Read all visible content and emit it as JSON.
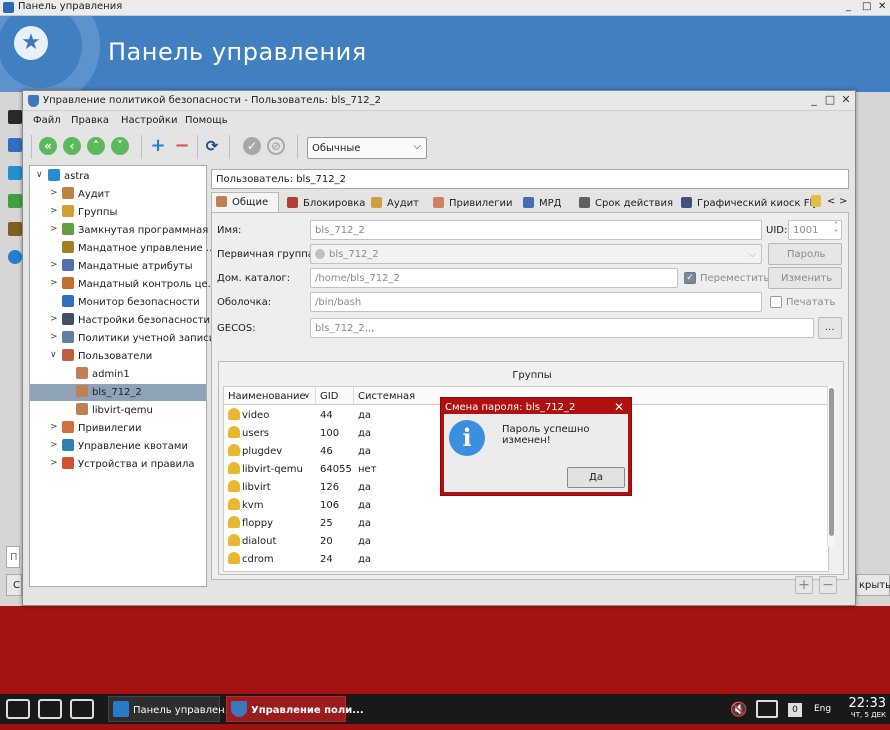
{
  "outer": {
    "window_title": "Панель управления",
    "banner_title": "Панель управления",
    "left_input_placeholder": "П",
    "left_button": "С",
    "right_button": "крыть"
  },
  "window": {
    "title": "Управление политикой безопасности - Пользователь: bls_712_2",
    "controls": {
      "minimize": "_",
      "maximize": "□",
      "close": "✕"
    }
  },
  "menu": [
    "Файл",
    "Правка",
    "Настройки",
    "Помощь"
  ],
  "toolbar": {
    "combo_value": "Обычные",
    "colors": {
      "green": "#5cb85c",
      "blue": "#1e7fd6",
      "red": "#d9534f",
      "gray": "#a8a8a8"
    }
  },
  "tree": [
    {
      "label": "astra",
      "level": 0,
      "expander": "∨"
    },
    {
      "label": "Аудит",
      "level": 1,
      "expander": ">"
    },
    {
      "label": "Группы",
      "level": 1,
      "expander": ">"
    },
    {
      "label": "Замкнутая программная ...",
      "level": 1,
      "expander": ">"
    },
    {
      "label": "Мандатное управление ...",
      "level": 1,
      "expander": ""
    },
    {
      "label": "Мандатные атрибуты",
      "level": 1,
      "expander": ">"
    },
    {
      "label": "Мандатный контроль це...",
      "level": 1,
      "expander": ">"
    },
    {
      "label": "Монитор безопасности",
      "level": 1,
      "expander": ""
    },
    {
      "label": "Настройки безопасности",
      "level": 1,
      "expander": ">"
    },
    {
      "label": "Политики учетной записи",
      "level": 1,
      "expander": ">"
    },
    {
      "label": "Пользователи",
      "level": 1,
      "expander": "∨"
    },
    {
      "label": "admin1",
      "level": 2,
      "expander": ""
    },
    {
      "label": "bls_712_2",
      "level": 2,
      "expander": "",
      "selected": true
    },
    {
      "label": "libvirt-qemu",
      "level": 2,
      "expander": ""
    },
    {
      "label": "Привилегии",
      "level": 1,
      "expander": ">"
    },
    {
      "label": "Управление квотами",
      "level": 1,
      "expander": ">"
    },
    {
      "label": "Устройства и правила",
      "level": 1,
      "expander": ">"
    }
  ],
  "user_header": "Пользователь: bls_712_2",
  "tabs": [
    "Общие",
    "Блокировка",
    "Аудит",
    "Привилегии",
    "МРД",
    "Срок действия",
    "Графический киоск Fly"
  ],
  "tab_scroll": {
    "left": "<",
    "right": ">"
  },
  "form": {
    "name_label": "Имя:",
    "name_value": "bls_712_2",
    "uid_label": "UID:",
    "uid_value": "1001",
    "primary_group_label": "Первичная группа:",
    "primary_group_value": "bls_712_2",
    "home_label": "Дом. каталог:",
    "home_value": "/home/bls_712_2",
    "move_label": "Переместить",
    "shell_label": "Оболочка:",
    "shell_value": "/bin/bash",
    "gecos_label": "GECOS:",
    "gecos_value": "bls_712_2,,,",
    "password_button": "Пароль",
    "change_button": "Изменить",
    "print_label": "Печатать",
    "ellipsis_button": "..."
  },
  "groups": {
    "title": "Группы",
    "columns": [
      "Наименование",
      "GID",
      "Системная"
    ],
    "rows": [
      [
        "video",
        "44",
        "да"
      ],
      [
        "users",
        "100",
        "да"
      ],
      [
        "plugdev",
        "46",
        "да"
      ],
      [
        "libvirt-qemu",
        "64055",
        "нет"
      ],
      [
        "libvirt",
        "126",
        "да"
      ],
      [
        "kvm",
        "106",
        "да"
      ],
      [
        "floppy",
        "25",
        "да"
      ],
      [
        "dialout",
        "20",
        "да"
      ],
      [
        "cdrom",
        "24",
        "да"
      ]
    ],
    "add": "+",
    "remove": "−"
  },
  "message": {
    "title": "Смена пароля: bls_712_2",
    "text": "Пароль успешно изменен!",
    "ok": "Да",
    "info_glyph": "i"
  },
  "taskbar": {
    "items": [
      {
        "label": "Панель управлен..."
      },
      {
        "label": "Управление поли..."
      }
    ],
    "badge": "0",
    "lang": "Eng",
    "time": "22:33",
    "date": "ЧТ, 5 ДЕК"
  }
}
